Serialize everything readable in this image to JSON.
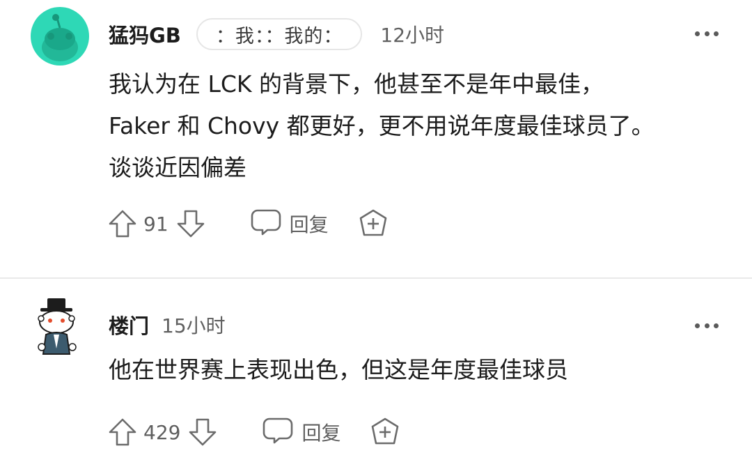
{
  "comments": [
    {
      "username": "猛犸GB",
      "flair": "：我：：我的：",
      "timestamp": "12小时",
      "body": "我认为在 LCK 的背景下，他甚至不是年中最佳，\nFaker 和 Chovy 都更好，更不用说年度最佳球员了。\n谈谈近因偏差",
      "votes": "91",
      "reply_label": "回复",
      "avatar": "snoo-teal-avatar",
      "avatar_color": "#2ed8b6"
    },
    {
      "username": "楼门",
      "timestamp": "15小时",
      "body": "他在世界赛上表现出色，但这是年度最佳球员",
      "votes": "429",
      "reply_label": "回复",
      "avatar": "snoo-top-hat-avatar"
    }
  ],
  "icons": {
    "upvote": "arrow-up-icon",
    "downvote": "arrow-down-icon",
    "reply": "speech-bubble-icon",
    "award": "plus-shield-icon",
    "more": "more-horizontal-icon"
  },
  "colors": {
    "icon_gray": "#6b6b6b",
    "text": "#1c1c1c",
    "meta": "#5f5f5f"
  }
}
